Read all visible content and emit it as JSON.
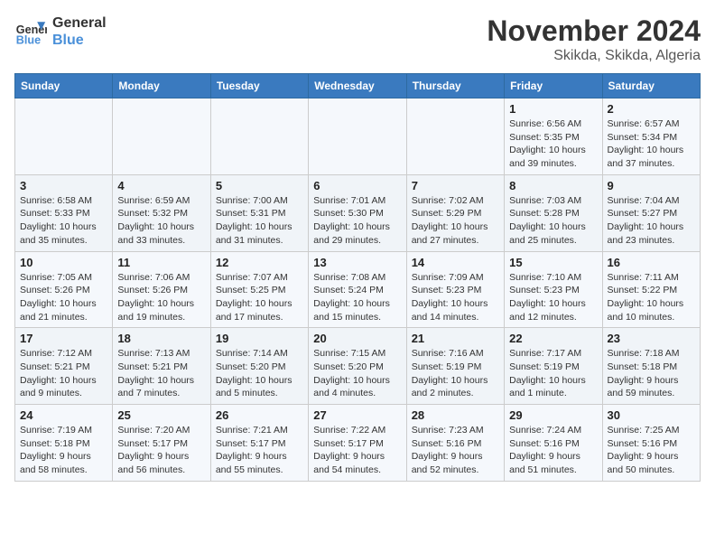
{
  "header": {
    "logo_line1": "General",
    "logo_line2": "Blue",
    "month": "November 2024",
    "location": "Skikda, Skikda, Algeria"
  },
  "days_of_week": [
    "Sunday",
    "Monday",
    "Tuesday",
    "Wednesday",
    "Thursday",
    "Friday",
    "Saturday"
  ],
  "weeks": [
    [
      {
        "day": "",
        "info": ""
      },
      {
        "day": "",
        "info": ""
      },
      {
        "day": "",
        "info": ""
      },
      {
        "day": "",
        "info": ""
      },
      {
        "day": "",
        "info": ""
      },
      {
        "day": "1",
        "info": "Sunrise: 6:56 AM\nSunset: 5:35 PM\nDaylight: 10 hours\nand 39 minutes."
      },
      {
        "day": "2",
        "info": "Sunrise: 6:57 AM\nSunset: 5:34 PM\nDaylight: 10 hours\nand 37 minutes."
      }
    ],
    [
      {
        "day": "3",
        "info": "Sunrise: 6:58 AM\nSunset: 5:33 PM\nDaylight: 10 hours\nand 35 minutes."
      },
      {
        "day": "4",
        "info": "Sunrise: 6:59 AM\nSunset: 5:32 PM\nDaylight: 10 hours\nand 33 minutes."
      },
      {
        "day": "5",
        "info": "Sunrise: 7:00 AM\nSunset: 5:31 PM\nDaylight: 10 hours\nand 31 minutes."
      },
      {
        "day": "6",
        "info": "Sunrise: 7:01 AM\nSunset: 5:30 PM\nDaylight: 10 hours\nand 29 minutes."
      },
      {
        "day": "7",
        "info": "Sunrise: 7:02 AM\nSunset: 5:29 PM\nDaylight: 10 hours\nand 27 minutes."
      },
      {
        "day": "8",
        "info": "Sunrise: 7:03 AM\nSunset: 5:28 PM\nDaylight: 10 hours\nand 25 minutes."
      },
      {
        "day": "9",
        "info": "Sunrise: 7:04 AM\nSunset: 5:27 PM\nDaylight: 10 hours\nand 23 minutes."
      }
    ],
    [
      {
        "day": "10",
        "info": "Sunrise: 7:05 AM\nSunset: 5:26 PM\nDaylight: 10 hours\nand 21 minutes."
      },
      {
        "day": "11",
        "info": "Sunrise: 7:06 AM\nSunset: 5:26 PM\nDaylight: 10 hours\nand 19 minutes."
      },
      {
        "day": "12",
        "info": "Sunrise: 7:07 AM\nSunset: 5:25 PM\nDaylight: 10 hours\nand 17 minutes."
      },
      {
        "day": "13",
        "info": "Sunrise: 7:08 AM\nSunset: 5:24 PM\nDaylight: 10 hours\nand 15 minutes."
      },
      {
        "day": "14",
        "info": "Sunrise: 7:09 AM\nSunset: 5:23 PM\nDaylight: 10 hours\nand 14 minutes."
      },
      {
        "day": "15",
        "info": "Sunrise: 7:10 AM\nSunset: 5:23 PM\nDaylight: 10 hours\nand 12 minutes."
      },
      {
        "day": "16",
        "info": "Sunrise: 7:11 AM\nSunset: 5:22 PM\nDaylight: 10 hours\nand 10 minutes."
      }
    ],
    [
      {
        "day": "17",
        "info": "Sunrise: 7:12 AM\nSunset: 5:21 PM\nDaylight: 10 hours\nand 9 minutes."
      },
      {
        "day": "18",
        "info": "Sunrise: 7:13 AM\nSunset: 5:21 PM\nDaylight: 10 hours\nand 7 minutes."
      },
      {
        "day": "19",
        "info": "Sunrise: 7:14 AM\nSunset: 5:20 PM\nDaylight: 10 hours\nand 5 minutes."
      },
      {
        "day": "20",
        "info": "Sunrise: 7:15 AM\nSunset: 5:20 PM\nDaylight: 10 hours\nand 4 minutes."
      },
      {
        "day": "21",
        "info": "Sunrise: 7:16 AM\nSunset: 5:19 PM\nDaylight: 10 hours\nand 2 minutes."
      },
      {
        "day": "22",
        "info": "Sunrise: 7:17 AM\nSunset: 5:19 PM\nDaylight: 10 hours\nand 1 minute."
      },
      {
        "day": "23",
        "info": "Sunrise: 7:18 AM\nSunset: 5:18 PM\nDaylight: 9 hours\nand 59 minutes."
      }
    ],
    [
      {
        "day": "24",
        "info": "Sunrise: 7:19 AM\nSunset: 5:18 PM\nDaylight: 9 hours\nand 58 minutes."
      },
      {
        "day": "25",
        "info": "Sunrise: 7:20 AM\nSunset: 5:17 PM\nDaylight: 9 hours\nand 56 minutes."
      },
      {
        "day": "26",
        "info": "Sunrise: 7:21 AM\nSunset: 5:17 PM\nDaylight: 9 hours\nand 55 minutes."
      },
      {
        "day": "27",
        "info": "Sunrise: 7:22 AM\nSunset: 5:17 PM\nDaylight: 9 hours\nand 54 minutes."
      },
      {
        "day": "28",
        "info": "Sunrise: 7:23 AM\nSunset: 5:16 PM\nDaylight: 9 hours\nand 52 minutes."
      },
      {
        "day": "29",
        "info": "Sunrise: 7:24 AM\nSunset: 5:16 PM\nDaylight: 9 hours\nand 51 minutes."
      },
      {
        "day": "30",
        "info": "Sunrise: 7:25 AM\nSunset: 5:16 PM\nDaylight: 9 hours\nand 50 minutes."
      }
    ]
  ]
}
